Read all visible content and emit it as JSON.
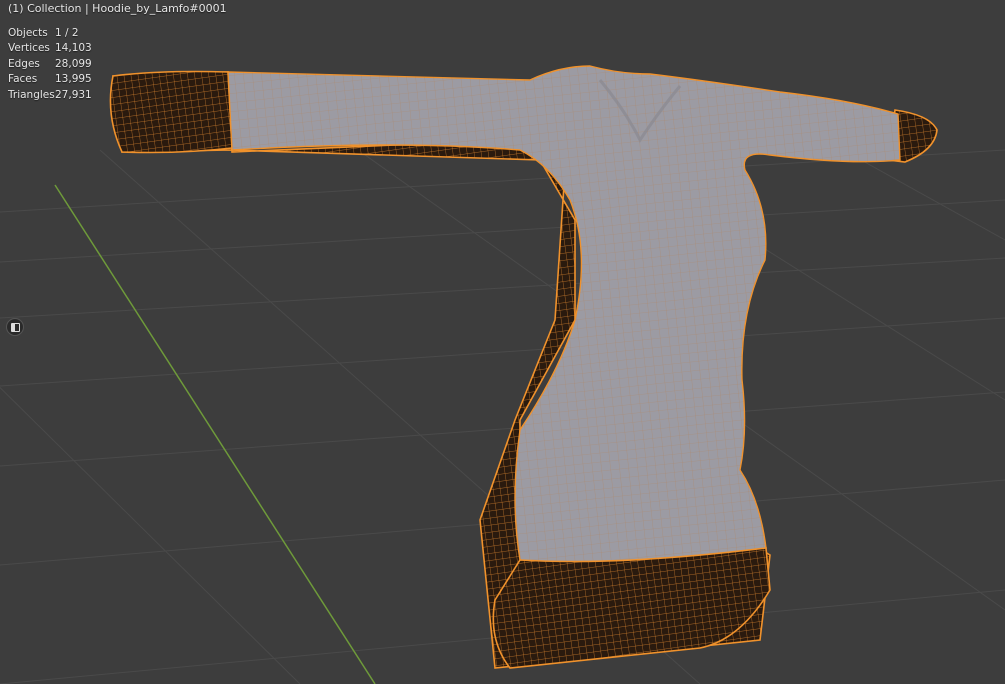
{
  "viewport": {
    "collection_label": "(1) Collection | Hoodie_by_Lamfo#0001",
    "stats": [
      {
        "label": "Objects",
        "value": "1 / 2"
      },
      {
        "label": "Vertices",
        "value": "14,103"
      },
      {
        "label": "Edges",
        "value": "28,099"
      },
      {
        "label": "Faces",
        "value": "13,995"
      },
      {
        "label": "Triangles",
        "value": "27,931"
      }
    ],
    "sidebar_toggle_icon": "toggle-sidebar-icon",
    "colors": {
      "background": "#3d3d3d",
      "grid": "#4a4a4a",
      "y_axis": "#6e9a3a",
      "mesh_fill": "#9c9ba3",
      "selection_outline": "#f0922c",
      "wire_dark": "#2a1a0e"
    }
  }
}
